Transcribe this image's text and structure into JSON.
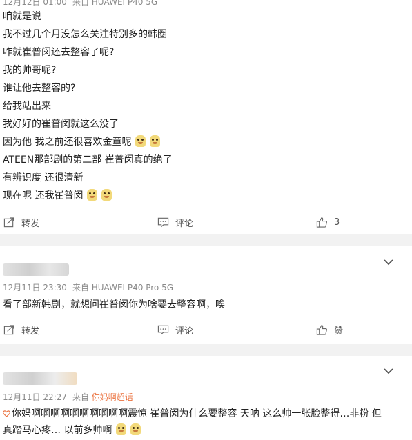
{
  "post1": {
    "meta_time": "12月12日 01:00",
    "meta_source": "来自 HUAWEI P40 5G",
    "lines": [
      "咱就是说",
      "我不过几个月没怎么关注特别多的韩圈",
      "咋就崔普闵还去整容了呢?",
      "我的帅哥呢?",
      "谁让他去整容的?",
      "给我站出来",
      "我好好的崔普闵就这么没了",
      "因为他 我之前还很喜欢金童呢",
      "ATEEN那部剧的第二部 崔普闵真的绝了",
      "有辨识度 还很清新",
      "现在呢 还我崔普闵"
    ],
    "share_label": "转发",
    "comment_label": "评论",
    "like_count": "3"
  },
  "post2": {
    "meta_time": "12月11日 23:30",
    "meta_source": "来自 HUAWEI P40 Pro 5G",
    "text": "看了部新韩剧，就想问崔普闵你为啥要去整容啊，唉",
    "share_label": "转发",
    "comment_label": "评论",
    "like_label": "赞"
  },
  "post3": {
    "meta_time": "12月11日 22:27",
    "meta_source_prefix": "来自",
    "meta_source_link": "你妈啊超话",
    "topic_tag": "你妈啊",
    "line1_rest": "啊啊啊啊啊啊啊啊啊震惊 崔普闵为什么要整容 天呐 这么帅一张脸整得…非粉 但",
    "line2": "真踏马心疼… 以前多帅啊"
  },
  "colors": {
    "accent": "#eb7340",
    "meta_gray": "#8a8a8a",
    "background": "#f2f2f2"
  },
  "icons": [
    "share-icon",
    "comment-icon",
    "thumbs-up-icon",
    "chevron-down-icon",
    "heart-icon",
    "emoji-icon"
  ]
}
